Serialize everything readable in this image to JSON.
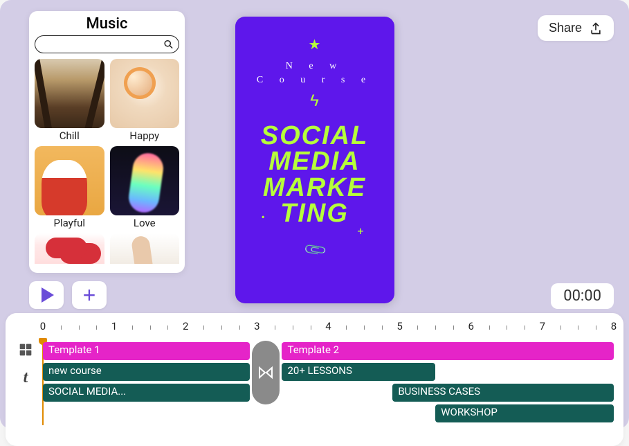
{
  "sidebar": {
    "title": "Music",
    "search_placeholder": "",
    "items": [
      {
        "label": "Chill"
      },
      {
        "label": "Happy"
      },
      {
        "label": "Playful"
      },
      {
        "label": "Love"
      }
    ]
  },
  "header": {
    "share_label": "Share"
  },
  "preview": {
    "subtitle": "N e w\nC o u r s e",
    "headline": "SOCIAL MEDIA MARKE TING"
  },
  "controls": {
    "time": "00:00"
  },
  "timeline": {
    "ruler_max": 8,
    "clips": [
      {
        "label": "Template 1",
        "row": 0,
        "start": 0,
        "end": 2.9,
        "color": "pink"
      },
      {
        "label": "Template 2",
        "row": 0,
        "start": 3.35,
        "end": 8,
        "color": "pink"
      },
      {
        "label": "new course",
        "row": 1,
        "start": 0,
        "end": 2.9,
        "color": "teal"
      },
      {
        "label": "20+ LESSONS",
        "row": 1,
        "start": 3.35,
        "end": 5.5,
        "color": "teal"
      },
      {
        "label": "SOCIAL MEDIA...",
        "row": 2,
        "start": 0,
        "end": 2.9,
        "color": "teal"
      },
      {
        "label": "BUSINESS CASES",
        "row": 2,
        "start": 4.9,
        "end": 8,
        "color": "teal"
      },
      {
        "label": "WORKSHOP",
        "row": 3,
        "start": 5.5,
        "end": 8,
        "color": "teal"
      }
    ],
    "transition_at": 3.12
  },
  "colors": {
    "accent_purple": "#6a4cd8",
    "canvas_purple": "#5e17eb",
    "neon_green": "#b6ff3b",
    "clip_pink": "#e524c8",
    "clip_teal": "#145c55"
  }
}
